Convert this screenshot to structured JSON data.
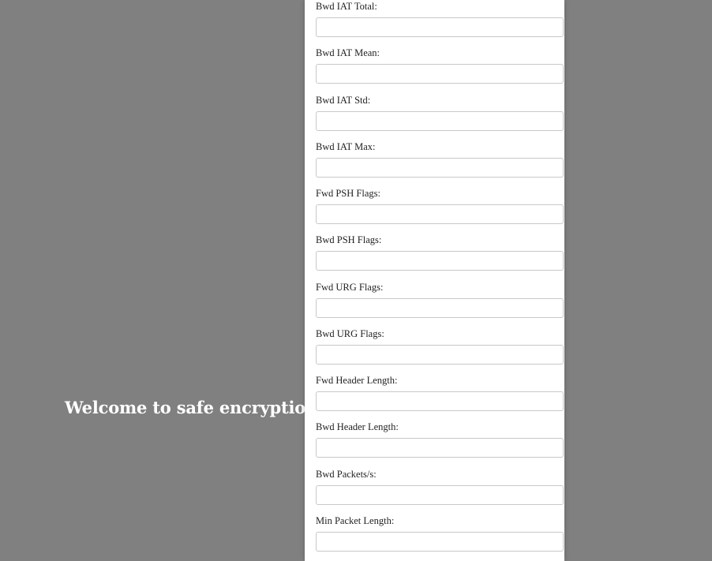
{
  "welcome_text": "Welcome to safe encryption",
  "form": {
    "fields": [
      {
        "label": "Bwd IAT Total:",
        "value": "",
        "placeholder": ""
      },
      {
        "label": "Bwd IAT Mean:",
        "value": "",
        "placeholder": ""
      },
      {
        "label": "Bwd IAT Std:",
        "value": "",
        "placeholder": ""
      },
      {
        "label": "Bwd IAT Max:",
        "value": "",
        "placeholder": ""
      },
      {
        "label": "Fwd PSH Flags:",
        "value": "",
        "placeholder": ""
      },
      {
        "label": "Bwd PSH Flags:",
        "value": "",
        "placeholder": ""
      },
      {
        "label": "Fwd URG Flags:",
        "value": "",
        "placeholder": ""
      },
      {
        "label": "Bwd URG Flags:",
        "value": "",
        "placeholder": ""
      },
      {
        "label": "Fwd Header Length:",
        "value": "",
        "placeholder": ""
      },
      {
        "label": "Bwd Header Length:",
        "value": "",
        "placeholder": ""
      },
      {
        "label": "Bwd Packets/s:",
        "value": "",
        "placeholder": ""
      },
      {
        "label": "Min Packet Length:",
        "value": "",
        "placeholder": ""
      }
    ]
  },
  "colors": {
    "background": "#808080",
    "panel": "#ffffff",
    "welcome_text": "#ffffff",
    "label_text": "#222222",
    "input_border": "#c8c8c8"
  }
}
